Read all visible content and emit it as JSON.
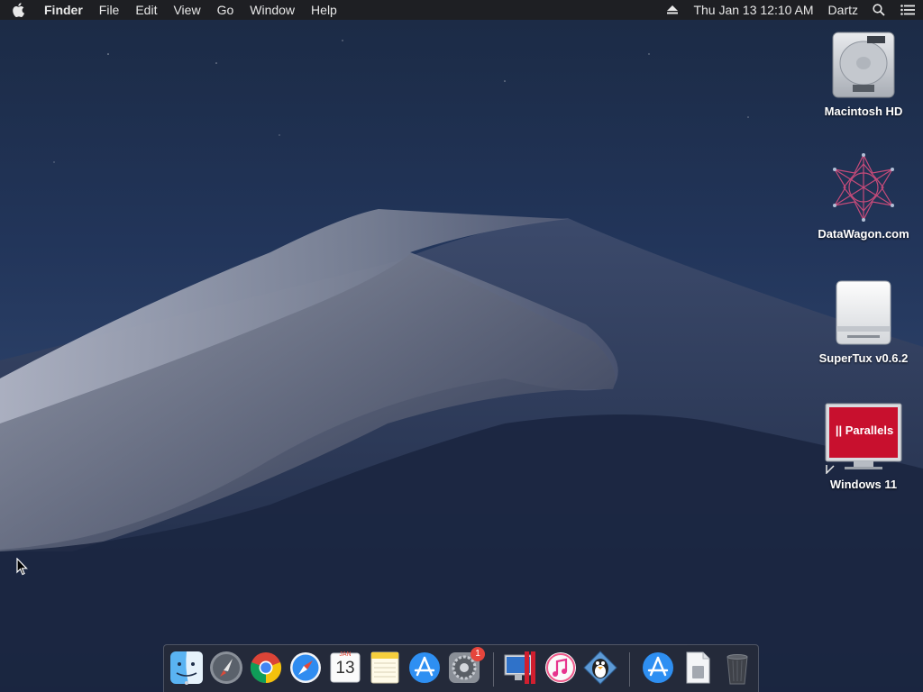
{
  "menubar": {
    "app_name": "Finder",
    "menus": [
      "File",
      "Edit",
      "View",
      "Go",
      "Window",
      "Help"
    ],
    "clock": "Thu Jan 13  12:10 AM",
    "user": "Dartz",
    "icons": [
      "apple-icon",
      "eject-icon",
      "spotlight-search-icon",
      "notification-center-icon"
    ]
  },
  "desktop": {
    "items": [
      {
        "label": "Macintosh HD",
        "icon": "hard-drive-icon"
      },
      {
        "label": "DataWagon.com",
        "icon": "network-star-icon"
      },
      {
        "label": "SuperTux v0.6.2",
        "icon": "removable-disk-icon"
      },
      {
        "label": "Windows 11",
        "icon": "parallels-vm-icon",
        "logo_text": "|| Parallels"
      }
    ]
  },
  "dock": {
    "apps": [
      {
        "name": "finder-icon",
        "running": true
      },
      {
        "name": "launchpad-icon"
      },
      {
        "name": "chrome-icon"
      },
      {
        "name": "safari-icon"
      },
      {
        "name": "calendar-icon",
        "month": "JAN",
        "day": "13"
      },
      {
        "name": "notes-icon"
      },
      {
        "name": "app-store-icon"
      },
      {
        "name": "system-preferences-icon",
        "badge": "1"
      },
      {
        "name": "parallels-icon"
      },
      {
        "name": "itunes-icon"
      },
      {
        "name": "supertux-icon"
      },
      {
        "name": "downloads-appstore-icon"
      },
      {
        "name": "document-icon"
      },
      {
        "name": "trash-icon"
      }
    ]
  },
  "colors": {
    "menubar_bg": "#1e1f23",
    "badge": "#e6453c",
    "parallels_red": "#c8102e"
  }
}
